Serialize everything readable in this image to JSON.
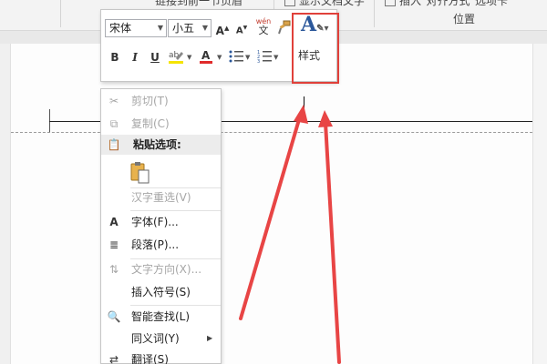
{
  "ribbon": {
    "cut_text_1": "链接到前一节页眉",
    "cut_text_2": "显示文档文字",
    "cut_text_3": "插入\"对齐方式\"选项卡",
    "group_position": "位置"
  },
  "minibar": {
    "font_name": "宋体",
    "font_size": "小五",
    "grow_font": "A",
    "shrink_font": "A",
    "phonetic_top": "wén",
    "phonetic_bottom": "文",
    "bold": "B",
    "italic": "I",
    "underline": "U",
    "highlight_color": "#f5e400",
    "font_color": "#e02b2b",
    "style_glyph": "A",
    "style_label": "样式"
  },
  "context_menu": {
    "items": [
      {
        "label": "剪切(T)",
        "icon": "scissors-icon",
        "enabled": false
      },
      {
        "label": "复制(C)",
        "icon": "copy-icon",
        "enabled": false
      },
      {
        "label": "粘贴选项:",
        "icon": "paste-icon",
        "enabled": true,
        "header": true
      },
      {
        "label": "汉字重选(V)",
        "icon": "",
        "enabled": false
      },
      {
        "label": "字体(F)...",
        "icon": "font-icon",
        "enabled": true
      },
      {
        "label": "段落(P)...",
        "icon": "paragraph-icon",
        "enabled": true
      },
      {
        "label": "文字方向(X)...",
        "icon": "text-direction-icon",
        "enabled": false
      },
      {
        "label": "插入符号(S)",
        "icon": "",
        "enabled": true
      },
      {
        "label": "智能查找(L)",
        "icon": "smart-lookup-icon",
        "enabled": true
      },
      {
        "label": "同义词(Y)",
        "icon": "",
        "enabled": true,
        "submenu": true
      },
      {
        "label": "翻译(S)",
        "icon": "translate-icon",
        "enabled": true
      }
    ]
  },
  "colors": {
    "annotation_red": "#e0403a",
    "arrow_red": "#e84545"
  }
}
